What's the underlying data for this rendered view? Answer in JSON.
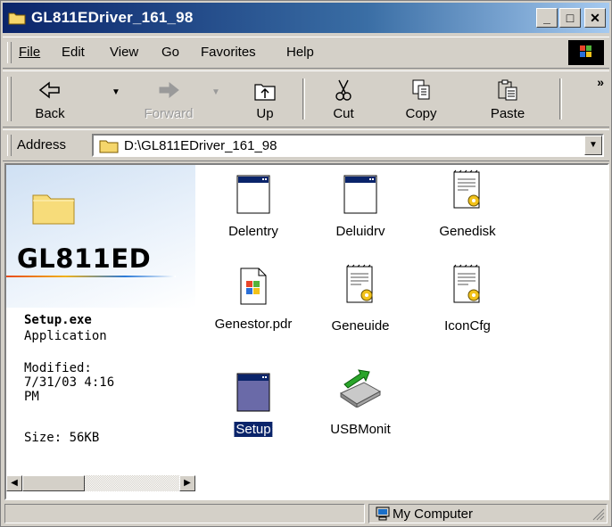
{
  "window": {
    "title": "GL811EDriver_161_98"
  },
  "title_buttons": {
    "minimize": "_",
    "maximize": "□",
    "close": "✕"
  },
  "menu": [
    {
      "label": "File"
    },
    {
      "label": "Edit"
    },
    {
      "label": "View"
    },
    {
      "label": "Go"
    },
    {
      "label": "Favorites"
    },
    {
      "label": "Help"
    }
  ],
  "toolbar": {
    "back_label": "Back",
    "forward_label": "Forward",
    "up_label": "Up",
    "cut_label": "Cut",
    "copy_label": "Copy",
    "paste_label": "Paste",
    "more": "»"
  },
  "address": {
    "label": "Address",
    "value": "D:\\GL811EDriver_161_98"
  },
  "panel": {
    "folder_title": "GL811ED",
    "file_name": "Setup.exe",
    "file_type": "Application",
    "modified_label": "Modified:",
    "modified_value_line1": "7/31/03 4:16",
    "modified_value_line2": "PM",
    "size_text": "Size: 56KB"
  },
  "files": [
    {
      "name": "Delentry",
      "icon": "window-app-icon",
      "selected": false
    },
    {
      "name": "Deluidrv",
      "icon": "window-app-icon",
      "selected": false
    },
    {
      "name": "Genedisk",
      "icon": "config-settings-icon",
      "selected": false
    },
    {
      "name": "Genestor.pdr",
      "icon": "windows-file-icon",
      "selected": false
    },
    {
      "name": "Geneuide",
      "icon": "config-settings-icon",
      "selected": false
    },
    {
      "name": "IconCfg",
      "icon": "config-settings-icon",
      "selected": false
    },
    {
      "name": "Setup",
      "icon": "window-app-icon",
      "selected": true
    },
    {
      "name": "USBMonit",
      "icon": "usb-drive-icon",
      "selected": false
    }
  ],
  "status": {
    "location": "My Computer"
  },
  "colors": {
    "titlebar": "#0a246a",
    "selection": "#0a246a",
    "chrome": "#d4d0c8"
  }
}
